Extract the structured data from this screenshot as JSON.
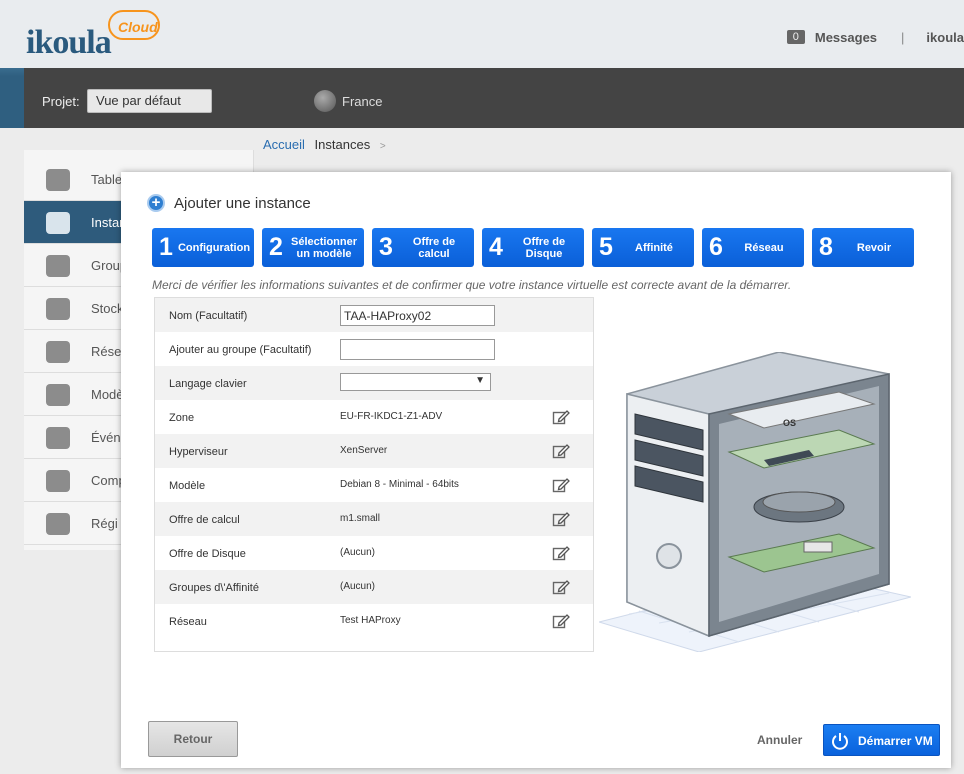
{
  "header": {
    "logo_text": "ikoula",
    "logo_cloud": "Cloud",
    "messages_count": "0",
    "messages_label": "Messages",
    "separator": "|",
    "user": "ikoula"
  },
  "project_bar": {
    "label": "Projet:",
    "selected_project": "Vue par défaut",
    "region": "France"
  },
  "sidebar": {
    "items": [
      {
        "label": "Table"
      },
      {
        "label": "Instar"
      },
      {
        "label": "Group"
      },
      {
        "label": "Stock"
      },
      {
        "label": "Rése"
      },
      {
        "label": "Modè"
      },
      {
        "label": "Évén"
      },
      {
        "label": "Comp"
      },
      {
        "label": "Régi"
      }
    ]
  },
  "breadcrumb": {
    "home": "Accueil",
    "current": "Instances",
    "sep": ">"
  },
  "modal": {
    "title": "Ajouter une instance",
    "steps": [
      {
        "num": "1",
        "label": "Configuration"
      },
      {
        "num": "2",
        "label": "Sélectionner un modèle"
      },
      {
        "num": "3",
        "label": "Offre de calcul"
      },
      {
        "num": "4",
        "label": "Offre de Disque"
      },
      {
        "num": "5",
        "label": "Affinité"
      },
      {
        "num": "6",
        "label": "Réseau"
      },
      {
        "num": "8",
        "label": "Revoir"
      }
    ],
    "info": "Merci de vérifier les informations suivantes et de confirmer que votre instance virtuelle est correcte avant de la démarrer.",
    "fields": {
      "nom": {
        "label": "Nom (Facultatif)",
        "value": "TAA-HAProxy02"
      },
      "groupe": {
        "label": "Ajouter au groupe (Facultatif)",
        "value": ""
      },
      "clavier": {
        "label": "Langage clavier",
        "value": ""
      }
    },
    "rows": [
      {
        "label": "Zone",
        "value": "EU-FR-IKDC1-Z1-ADV"
      },
      {
        "label": "Hyperviseur",
        "value": "XenServer"
      },
      {
        "label": "Modèle",
        "value": "Debian 8 - Minimal - 64bits"
      },
      {
        "label": "Offre de calcul",
        "value": "m1.small"
      },
      {
        "label": "Offre de Disque",
        "value": "(Aucun)"
      },
      {
        "label": "Groupes d\\'Affinité",
        "value": "(Aucun)"
      },
      {
        "label": "Réseau",
        "value": "Test HAProxy"
      }
    ],
    "computer_os_label": "OS",
    "buttons": {
      "back": "Retour",
      "cancel": "Annuler",
      "start": "Démarrer VM"
    }
  },
  "colors": {
    "accent": "#0a5fd8",
    "header_dark": "#444444",
    "sidebar_active": "#2e5b7c"
  }
}
